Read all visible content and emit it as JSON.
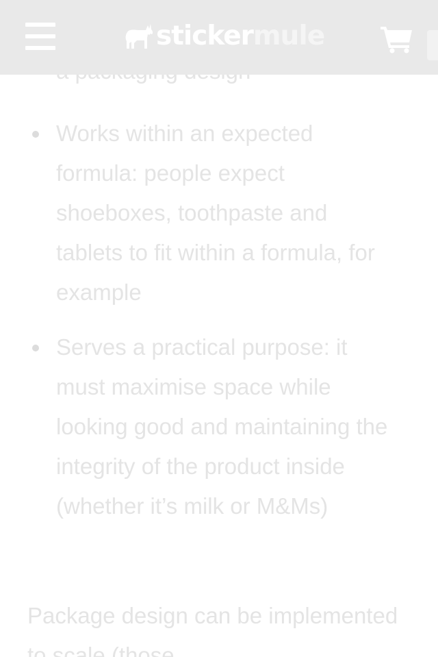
{
  "header": {
    "brand_part1": "sticker",
    "brand_part2": "mule",
    "menu_icon": "hamburger-menu-icon",
    "logo_icon": "mule-logo-icon",
    "cart_icon": "shopping-cart-icon",
    "background_color": "#e9e9e9"
  },
  "article": {
    "cut_off_line": "a packaging design",
    "bullets": [
      {
        "text": "Works within an expected formula: people expect shoeboxes, toothpaste and tablets to fit within a formula, for example"
      },
      {
        "text": "Serves a practical purpose: it must maximise space while looking good and maintaining the integrity of the product inside (whether it’s milk or M&Ms)"
      }
    ],
    "paragraph": "Package design can be implemented to scale (those"
  }
}
